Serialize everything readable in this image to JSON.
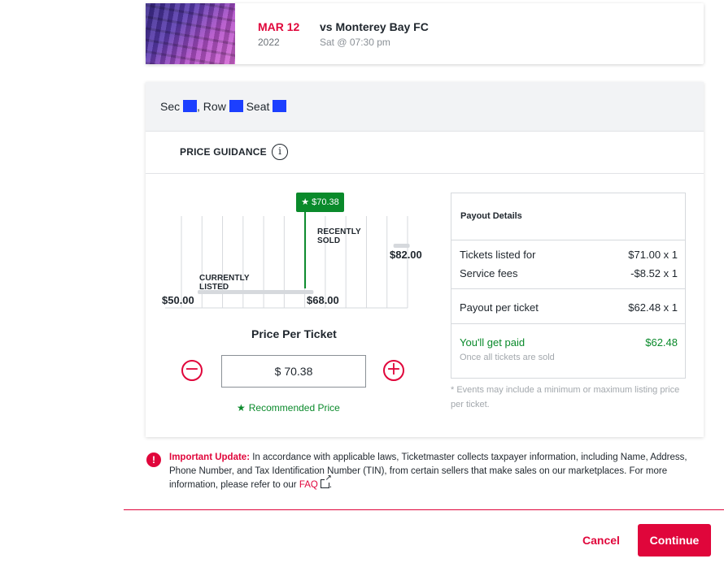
{
  "event": {
    "month_day": "MAR 12",
    "year": "2022",
    "name": "vs Monterey Bay FC",
    "time": "Sat @ 07:30 pm"
  },
  "seat": {
    "sec_label": "Sec",
    "row_label": "Row",
    "seat_label": "Seat"
  },
  "price_guidance": {
    "label": "PRICE GUIDANCE",
    "info_glyph": "i"
  },
  "chart_data": {
    "type": "range",
    "x_min_label": "$50.00",
    "x_mid_label": "$68.00",
    "x_max_label": "$82.00",
    "currently_listed_label": "CURRENTLY LISTED",
    "recently_sold_label": "RECENTLY SOLD",
    "recommended_pin": "★ $70.38",
    "currently_listed_range": [
      50,
      68
    ],
    "recently_sold_range": [
      80,
      82
    ],
    "recommended_value": 70.38,
    "axis_range": [
      50,
      82
    ]
  },
  "pricing": {
    "per_ticket_label": "Price Per Ticket",
    "price_value": "$ 70.38",
    "decrement_glyph": "−",
    "increment_glyph": "+",
    "recommended_label": "Recommended Price",
    "recommended_star": "★"
  },
  "payout": {
    "title": "Payout Details",
    "tickets_listed_label": "Tickets listed for",
    "tickets_listed_value": "$71.00 x 1",
    "service_fees_label": "Service fees",
    "service_fees_value": "-$8.52 x 1",
    "per_ticket_label": "Payout per ticket",
    "per_ticket_value": "$62.48 x 1",
    "get_paid_label": "You'll get paid",
    "get_paid_value": "$62.48",
    "note": "Once all tickets are sold",
    "disclaimer": "* Events may include a minimum or maximum listing price per ticket."
  },
  "update": {
    "icon_glyph": "!",
    "title": "Important Update:",
    "body": "In accordance with applicable laws, Ticketmaster collects taxpayer information, including Name, Address, Phone Number, and Tax Identification Number (TIN), from certain sellers that make sales on our marketplaces. For more information, please refer to our",
    "faq": "FAQ"
  },
  "actions": {
    "cancel": "Cancel",
    "continue": "Continue"
  },
  "colors": {
    "brand": "#e0063b",
    "success": "#0a8a2b",
    "redaction": "#1c3fff"
  }
}
